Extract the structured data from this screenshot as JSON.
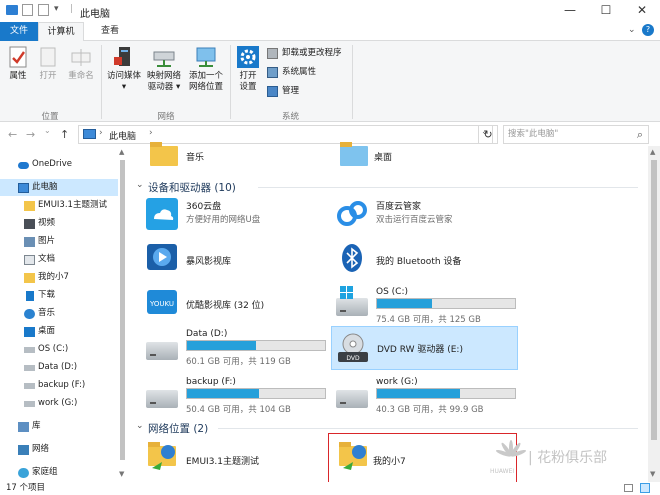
{
  "window": {
    "title": "此电脑"
  },
  "controls": {
    "minimize": "—",
    "maximize": "☐",
    "close": "✕"
  },
  "tabs": [
    {
      "label": "文件"
    },
    {
      "label": "计算机"
    },
    {
      "label": "查看"
    }
  ],
  "ribbon": {
    "location": {
      "label": "位置",
      "buttons": [
        {
          "label": "属性"
        },
        {
          "label": "打开"
        },
        {
          "label": "重命名"
        }
      ]
    },
    "network": {
      "label": "网络",
      "buttons": [
        {
          "label": "访问媒体",
          "arrow": "▾"
        },
        {
          "label1": "映射网络",
          "label2": "驱动器",
          "arrow": "▾"
        },
        {
          "label1": "添加一个",
          "label2": "网络位置"
        }
      ]
    },
    "system": {
      "label": "系统",
      "open_settings": {
        "label1": "打开",
        "label2": "设置"
      },
      "items": [
        {
          "label": "卸载或更改程序"
        },
        {
          "label": "系统属性"
        },
        {
          "label": "管理"
        }
      ]
    }
  },
  "address": {
    "back": "←",
    "forward": "→",
    "up_arrow": "⌄",
    "up": "↑",
    "path": "此电脑",
    "sep": "›",
    "dropdown": "⌄",
    "refresh": "↻",
    "search_placeholder": "搜索\"此电脑\"",
    "search_icon": "⌕"
  },
  "nav": {
    "items": [
      {
        "label": "OneDrive"
      },
      {
        "label": "此电脑"
      },
      {
        "label": "EMUI3.1主题测试"
      },
      {
        "label": "视频"
      },
      {
        "label": "图片"
      },
      {
        "label": "文档"
      },
      {
        "label": "我的小7"
      },
      {
        "label": "下载"
      },
      {
        "label": "音乐"
      },
      {
        "label": "桌面"
      },
      {
        "label": "OS (C:)"
      },
      {
        "label": "Data (D:)"
      },
      {
        "label": "backup (F:)"
      },
      {
        "label": "work (G:)"
      },
      {
        "label": "库"
      },
      {
        "label": "网络"
      },
      {
        "label": "家庭组"
      }
    ],
    "scroll_up": "▲",
    "scroll_down": "▼"
  },
  "folders": [
    {
      "label": "音乐"
    },
    {
      "label": "桌面"
    }
  ],
  "devices": {
    "header": "设备和驱动器 (10)",
    "chevron": "⌄",
    "items": [
      {
        "name": "360云盘",
        "sub": "方便好用的网络U盘"
      },
      {
        "name": "百度云管家",
        "sub": "双击运行百度云管家"
      },
      {
        "name": "暴风影视库"
      },
      {
        "name": "我的 Bluetooth 设备"
      },
      {
        "name": "优酷影视库 (32 位)",
        "logo": "YOUKU"
      },
      {
        "name": "OS (C:)",
        "sub": "75.4 GB 可用，共 125 GB",
        "used": 0.4
      },
      {
        "name": "Data (D:)",
        "sub": "60.1 GB 可用，共 119 GB",
        "used": 0.5
      },
      {
        "name": "DVD RW 驱动器 (E:)",
        "disc": "DVD"
      },
      {
        "name": "backup (F:)",
        "sub": "50.4 GB 可用，共 104 GB",
        "used": 0.52
      },
      {
        "name": "work (G:)",
        "sub": "40.3 GB 可用，共 99.9 GB",
        "used": 0.6
      }
    ]
  },
  "network_locations": {
    "header": "网络位置 (2)",
    "chevron": "⌄",
    "items": [
      {
        "name": "EMUI3.1主题测试"
      },
      {
        "name": "我的小7"
      }
    ]
  },
  "scroll": {
    "up": "▲",
    "down": "▼"
  },
  "status": {
    "count": "17 个项目"
  },
  "watermark": {
    "brand": "HUAWEI",
    "text": "| 花粉俱乐部"
  },
  "colors": {
    "accent": "#1979ca",
    "bar": "#26a0da",
    "selection": "#cce8ff",
    "highlight_border": "#d9262a"
  }
}
